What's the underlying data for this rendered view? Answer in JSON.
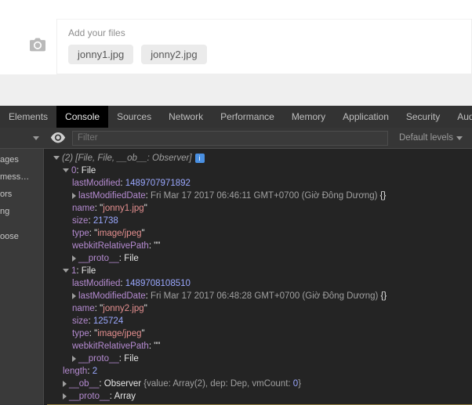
{
  "form": {
    "label": "Add your files",
    "attachments": [
      "jonny1.jpg",
      "jonny2.jpg"
    ]
  },
  "devtools": {
    "tabs": [
      "Elements",
      "Console",
      "Sources",
      "Network",
      "Performance",
      "Memory",
      "Application",
      "Security",
      "Audits"
    ],
    "activeTab": "Console",
    "filterPlaceholder": "Filter",
    "levels": "Default levels",
    "sidebar": [
      "ages",
      "mess…",
      "ors",
      "ng",
      "",
      "oose"
    ]
  },
  "console": {
    "summary": "(2) [File, File, __ob__: Observer]",
    "arr": [
      {
        "index": "0",
        "type": "File",
        "lastModified": "1489707971892",
        "lastModifiedDate": "Fri Mar 17 2017 06:46:11 GMT+0700 (Giờ Đông Dương)",
        "name": "jonny1.jpg",
        "size": "21738",
        "mime": "image/jpeg",
        "webkitRelativePath": "",
        "proto": "File"
      },
      {
        "index": "1",
        "type": "File",
        "lastModified": "1489708108510",
        "lastModifiedDate": "Fri Mar 17 2017 06:48:28 GMT+0700 (Giờ Đông Dương)",
        "name": "jonny2.jpg",
        "size": "125724",
        "mime": "image/jpeg",
        "webkitRelativePath": "",
        "proto": "File"
      }
    ],
    "length": "2",
    "obLine": {
      "k": "__ob__",
      "t": "Observer",
      "v": "value",
      "va": "Array(2)",
      "d": "dep",
      "dv": "Dep",
      "vm": "vmCount",
      "vmn": "0"
    },
    "protoArr": {
      "k": "__proto__",
      "v": "Array"
    }
  }
}
